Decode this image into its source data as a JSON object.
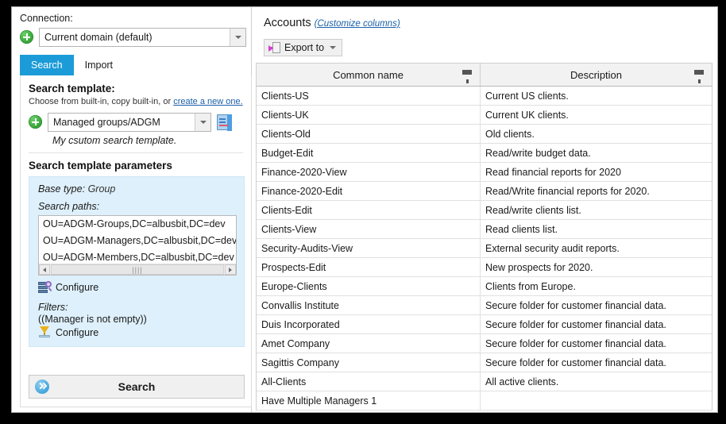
{
  "connection": {
    "label": "Connection:",
    "add_icon": "plus-circle-icon",
    "value": "Current domain (default)",
    "dropdown_icon": "chevron-down-icon"
  },
  "tabs": [
    {
      "label": "Search",
      "active": true
    },
    {
      "label": "Import",
      "active": false
    }
  ],
  "search_panel": {
    "template_title": "Search template:",
    "template_hint_prefix": "Choose from built-in, copy built-in, or ",
    "template_hint_link": "create a new one.",
    "template_add_icon": "plus-circle-icon",
    "template_value": "Managed groups/ADGM",
    "template_dropdown_icon": "chevron-down-icon",
    "template_edit_icon": "template-document-icon",
    "template_description": "My csutom search template.",
    "parameters_title": "Search template parameters",
    "base_type_label": "Base type:",
    "base_type_value": "Group",
    "search_paths_label": "Search paths:",
    "search_paths": [
      "OU=ADGM-Groups,DC=albusbit,DC=dev",
      "OU=ADGM-Managers,DC=albusbit,DC=dev",
      "OU=ADGM-Members,DC=albusbit,DC=dev"
    ],
    "scroll_left_icon": "caret-left-icon",
    "scroll_right_icon": "caret-right-icon",
    "scroll_thumb_grip": "||||",
    "paths_configure_label": "Configure",
    "paths_configure_icon": "server-search-icon",
    "filters_label": "Filters:",
    "filters_value": "((Manager is not empty))",
    "filters_configure_label": "Configure",
    "filters_configure_icon": "funnel-filter-icon",
    "search_button_label": "Search",
    "search_button_icon": "double-chevron-right-icon"
  },
  "accounts": {
    "title": "Accounts",
    "customize_link": "(Customize columns)",
    "export_label": "Export to",
    "export_icon": "export-document-icon",
    "export_caret_icon": "chevron-down-icon",
    "columns": [
      {
        "label": "Common name",
        "filter_icon": "column-filter-icon"
      },
      {
        "label": "Description",
        "filter_icon": "column-filter-icon"
      }
    ],
    "rows": [
      {
        "common_name": "Clients-US",
        "description": "Current US clients."
      },
      {
        "common_name": "Clients-UK",
        "description": "Current UK clients."
      },
      {
        "common_name": "Clients-Old",
        "description": "Old clients."
      },
      {
        "common_name": "Budget-Edit",
        "description": "Read/write budget data."
      },
      {
        "common_name": "Finance-2020-View",
        "description": "Read financial reports for 2020"
      },
      {
        "common_name": "Finance-2020-Edit",
        "description": "Read/Write financial reports for 2020."
      },
      {
        "common_name": "Clients-Edit",
        "description": "Read/write clients list."
      },
      {
        "common_name": "Clients-View",
        "description": "Read clients list."
      },
      {
        "common_name": "Security-Audits-View",
        "description": "External security audit reports."
      },
      {
        "common_name": "Prospects-Edit",
        "description": "New prospects for 2020."
      },
      {
        "common_name": "Europe-Clients",
        "description": "Clients from Europe."
      },
      {
        "common_name": "Convallis Institute",
        "description": "Secure folder for customer financial data."
      },
      {
        "common_name": "Duis Incorporated",
        "description": "Secure folder for customer financial data."
      },
      {
        "common_name": "Amet Company",
        "description": "Secure folder for customer financial data."
      },
      {
        "common_name": "Sagittis Company",
        "description": "Secure folder for customer financial data."
      },
      {
        "common_name": "All-Clients",
        "description": "All active clients."
      },
      {
        "common_name": "Have Multiple Managers 1",
        "description": ""
      }
    ]
  },
  "colors": {
    "accent_blue": "#1b9bd8",
    "panel_blue": "#def0fb",
    "link_blue": "#1a5fa8",
    "add_green": "#3aa83a",
    "funnel_gold": "#e8b11e",
    "export_magenta": "#d43fd4"
  }
}
